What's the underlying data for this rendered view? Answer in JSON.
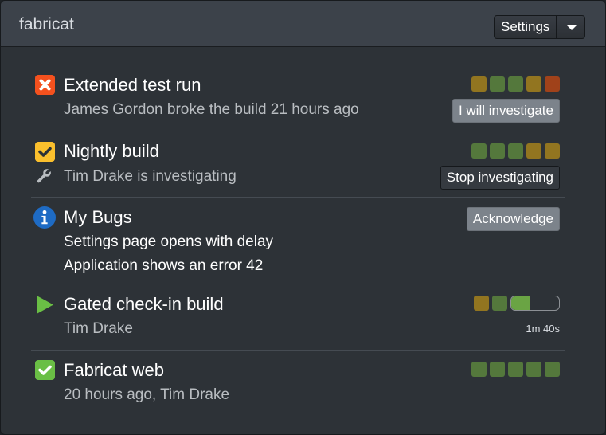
{
  "header": {
    "title": "fabricat",
    "settings_label": "Settings",
    "dropdown_icon": "caret-down-icon"
  },
  "colors": {
    "failed": "#f4511e",
    "warning": "#fbc02d",
    "info": "#1976d2",
    "running": "#6abf45",
    "success": "#6abf45",
    "history_green": "#54783c",
    "history_yellow": "#927520",
    "history_red": "#a0421a"
  },
  "builds": [
    {
      "status_icon": "failed-x-icon",
      "name": "Extended test run",
      "subtitle": "James Gordon broke the build 21 hours ago",
      "history": [
        "yellow",
        "green",
        "green",
        "yellow",
        "red"
      ],
      "action_label": "I will investigate"
    },
    {
      "status_icon": "warning-check-icon",
      "name": "Nightly build",
      "subtitle_icon": "wrench-icon",
      "subtitle": "Tim Drake is investigating",
      "history": [
        "green",
        "green",
        "green",
        "yellow",
        "yellow"
      ],
      "action_label": "Stop investigating"
    },
    {
      "status_icon": "info-icon",
      "name": "My Bugs",
      "bugs": [
        "Settings page opens with delay",
        "Application shows an error 42"
      ],
      "action_label": "Acknowledge"
    },
    {
      "status_icon": "play-icon",
      "name": "Gated check-in build",
      "subtitle": "Tim Drake",
      "history": [
        "yellow",
        "green"
      ],
      "progress": 0.4,
      "duration": "1m 40s"
    },
    {
      "status_icon": "success-check-icon",
      "name": "Fabricat web",
      "subtitle": "20 hours ago, Tim Drake",
      "history": [
        "green",
        "green",
        "green",
        "green",
        "green"
      ]
    }
  ]
}
